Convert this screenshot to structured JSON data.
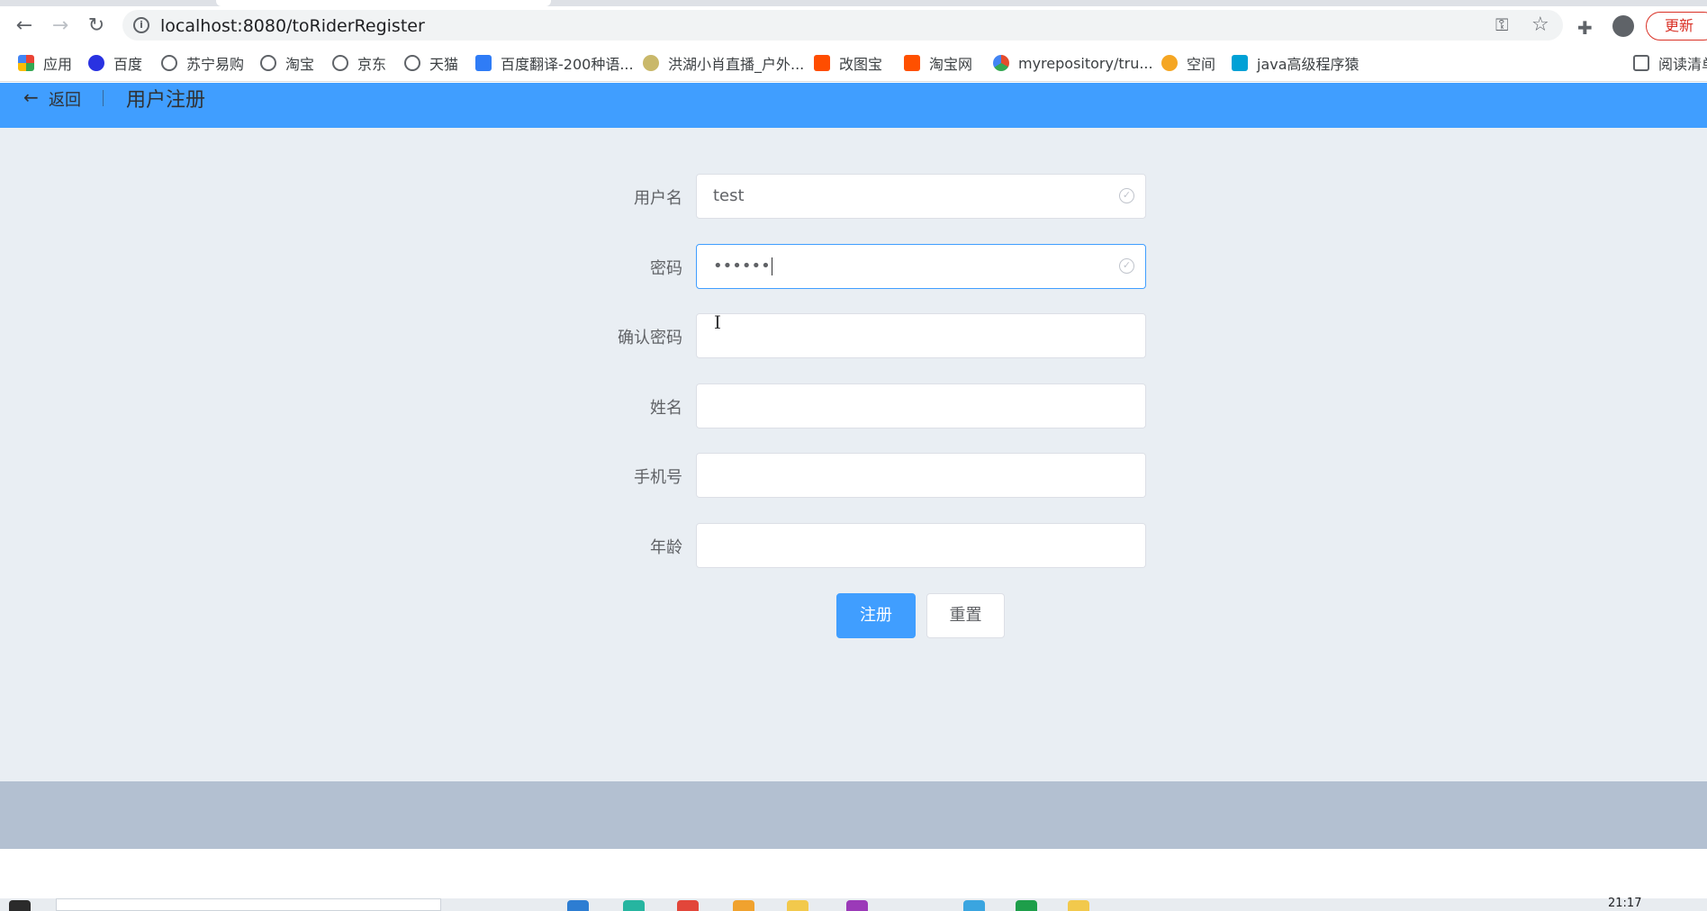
{
  "browser": {
    "url": "localhost:8080/toRiderRegister",
    "update_label": "更新",
    "bookmarks": [
      {
        "label": "应用",
        "icon": "apps-grid-icon",
        "color": "#ea4335"
      },
      {
        "label": "百度",
        "icon": "baidu-paw-icon",
        "color": "#2932e1"
      },
      {
        "label": "苏宁易购",
        "icon": "globe-icon",
        "color": "#5f6368"
      },
      {
        "label": "淘宝",
        "icon": "globe-icon",
        "color": "#5f6368"
      },
      {
        "label": "京东",
        "icon": "globe-icon",
        "color": "#5f6368"
      },
      {
        "label": "天猫",
        "icon": "globe-icon",
        "color": "#5f6368"
      },
      {
        "label": "百度翻译-200种语...",
        "icon": "translate-icon",
        "color": "#2f7cf6"
      },
      {
        "label": "洪湖小肖直播_户外...",
        "icon": "bird-icon",
        "color": "#7a6a2a"
      },
      {
        "label": "改图宝",
        "icon": "image-tool-icon",
        "color": "#ff4d00"
      },
      {
        "label": "淘宝网",
        "icon": "taobao-icon",
        "color": "#ff5000"
      },
      {
        "label": "myrepository/tru...",
        "icon": "repo-icon",
        "color": "#e44c2d"
      },
      {
        "label": "空间",
        "icon": "qzone-icon",
        "color": "#f5a623"
      },
      {
        "label": "java高级程序猿",
        "icon": "bilibili-icon",
        "color": "#00a1d6"
      }
    ],
    "reading_list_label": "阅读清单"
  },
  "header": {
    "back_label": "返回",
    "title": "用户注册"
  },
  "form": {
    "fields": [
      {
        "label": "用户名",
        "value": "test",
        "valid": true
      },
      {
        "label": "密码",
        "value": "••••••",
        "valid": true
      },
      {
        "label": "确认密码",
        "value": ""
      },
      {
        "label": "姓名",
        "value": ""
      },
      {
        "label": "手机号",
        "value": ""
      },
      {
        "label": "年龄",
        "value": ""
      }
    ],
    "submit_label": "注册",
    "reset_label": "重置"
  },
  "taskbar": {
    "time": "21:17"
  },
  "colors": {
    "primary": "#409eff",
    "content_bg": "#e9eef3",
    "footer_bg": "#b3c0d1"
  }
}
